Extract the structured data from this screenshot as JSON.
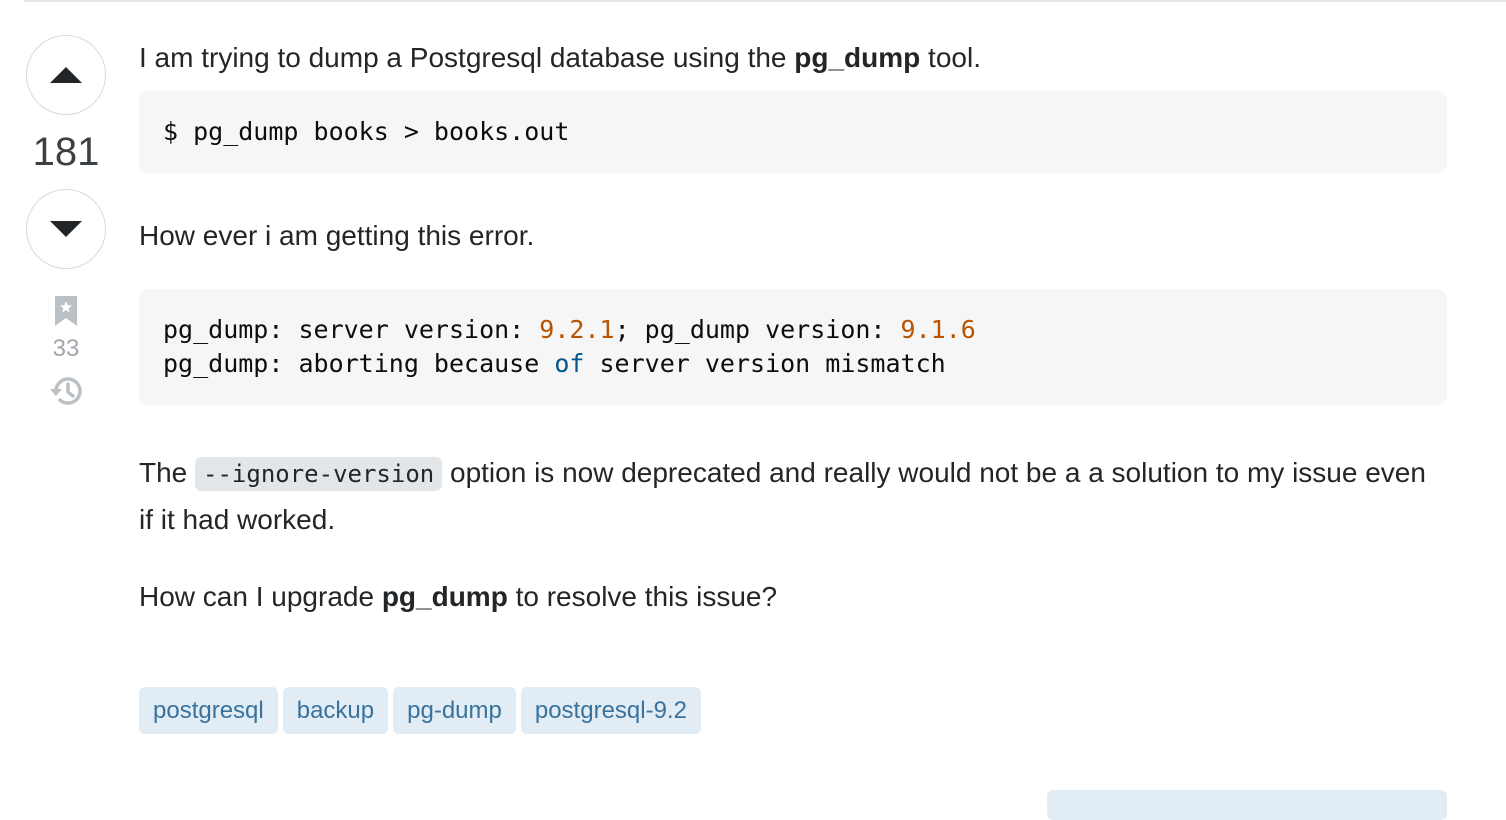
{
  "vote": {
    "score": "181",
    "bookmark_count": "33"
  },
  "post": {
    "p1_before": "I am trying to dump a Postgresql database using the ",
    "p1_bold": "pg_dump",
    "p1_after": " tool.",
    "code1": "$ pg_dump books > books.out",
    "p2": "How ever i am getting this error.",
    "code2": {
      "l1_a": "pg_dump: server version: ",
      "l1_num1": "9.2.1",
      "l1_b": "; pg_dump version: ",
      "l1_num2": "9.1.6",
      "l2_a": "pg_dump: aborting because ",
      "l2_kw": "of",
      "l2_b": " server version mismatch"
    },
    "p3_before": "The ",
    "p3_code": "--ignore-version",
    "p3_after": " option is now deprecated and really would not be a a solution to my issue even if it had worked.",
    "p4_before": "How can I upgrade ",
    "p4_bold": "pg_dump",
    "p4_after": " to resolve this issue?"
  },
  "tags": [
    "postgresql",
    "backup",
    "pg-dump",
    "postgresql-9.2"
  ],
  "icons": {
    "upvote": "caret-up-icon",
    "downvote": "caret-down-icon",
    "bookmark": "bookmark-icon",
    "history": "history-icon"
  },
  "colors": {
    "tag_bg": "#e1ecf4",
    "tag_text": "#39739d",
    "code_number": "#b75301",
    "code_keyword": "#015692"
  }
}
